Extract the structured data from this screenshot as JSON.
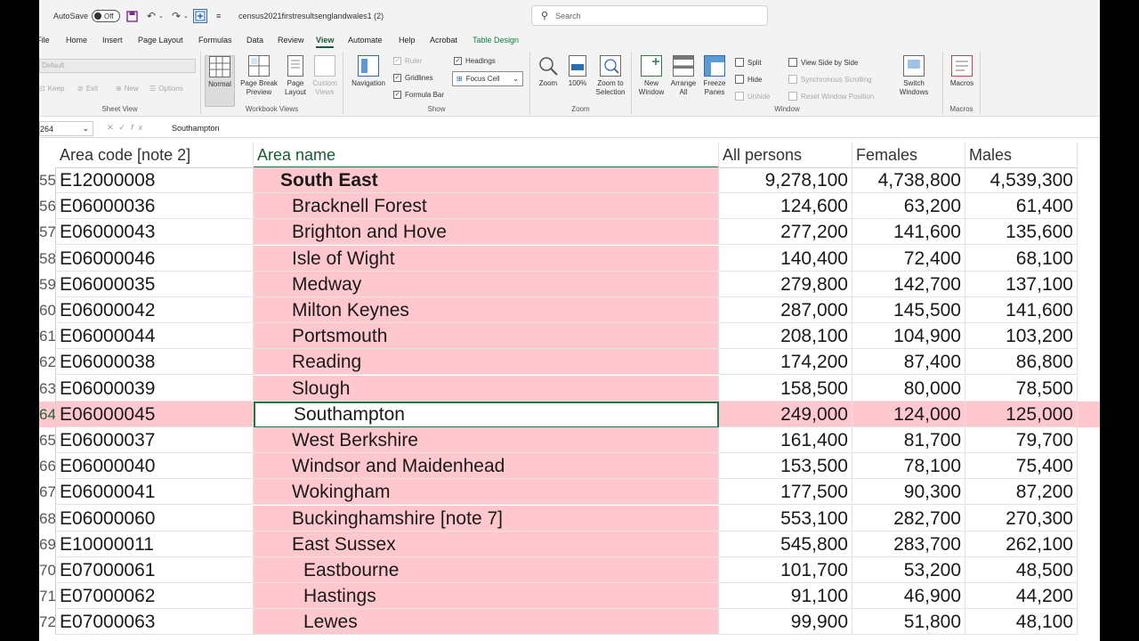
{
  "titlebar": {
    "autosave_label": "AutoSave",
    "autosave_state": "Off",
    "filename": "census2021firstresultsenglandwales1 (2)",
    "search_placeholder": "Search"
  },
  "tabs": [
    "File",
    "Home",
    "Insert",
    "Page Layout",
    "Formulas",
    "Data",
    "Review",
    "View",
    "Automate",
    "Help",
    "Acrobat",
    "Table Design"
  ],
  "active_tab": "View",
  "ribbon": {
    "sheet_view": {
      "dropdown": "Default",
      "keep": "Keep",
      "exit": "Exit",
      "new": "New",
      "options": "Options",
      "label": "Sheet View"
    },
    "workbook_views": {
      "normal": "Normal",
      "page_break": "Page Break Preview",
      "page_layout": "Page Layout",
      "custom": "Custom Views",
      "label": "Workbook Views"
    },
    "show": {
      "navigation": "Navigation",
      "ruler": "Ruler",
      "gridlines": "Gridlines",
      "formula_bar": "Formula Bar",
      "headings": "Headings",
      "focus_cell": "Focus Cell",
      "label": "Show"
    },
    "zoom": {
      "zoom": "Zoom",
      "hundred": "100%",
      "to_selection": "Zoom to Selection",
      "label": "Zoom"
    },
    "window": {
      "new_window": "New Window",
      "arrange_all": "Arrange All",
      "freeze_panes": "Freeze Panes",
      "split": "Split",
      "hide": "Hide",
      "unhide": "Unhide",
      "side_by_side": "View Side by Side",
      "sync_scroll": "Synchronous Scrolling",
      "reset_pos": "Reset Window Position",
      "switch_windows": "Switch Windows",
      "label": "Window"
    },
    "macros": {
      "macros": "Macros",
      "label": "Macros"
    }
  },
  "formula_bar": {
    "name_box": "264",
    "fx": "fx",
    "content": "Southampton"
  },
  "grid": {
    "headers": [
      "Area code [note 2]",
      "Area name",
      "All persons",
      "Females",
      "Males"
    ],
    "rows": [
      {
        "num": "55",
        "code": "E12000008",
        "name": "South East",
        "all": "9,278,100",
        "f": "4,738,800",
        "m": "4,539,300",
        "level": 0
      },
      {
        "num": "56",
        "code": "E06000036",
        "name": "Bracknell Forest",
        "all": "124,600",
        "f": "63,200",
        "m": "61,400",
        "level": 1
      },
      {
        "num": "57",
        "code": "E06000043",
        "name": "Brighton and Hove",
        "all": "277,200",
        "f": "141,600",
        "m": "135,600",
        "level": 1
      },
      {
        "num": "58",
        "code": "E06000046",
        "name": "Isle of Wight",
        "all": "140,400",
        "f": "72,400",
        "m": "68,100",
        "level": 1
      },
      {
        "num": "59",
        "code": "E06000035",
        "name": "Medway",
        "all": "279,800",
        "f": "142,700",
        "m": "137,100",
        "level": 1
      },
      {
        "num": "60",
        "code": "E06000042",
        "name": "Milton Keynes",
        "all": "287,000",
        "f": "145,500",
        "m": "141,600",
        "level": 1
      },
      {
        "num": "61",
        "code": "E06000044",
        "name": "Portsmouth",
        "all": "208,100",
        "f": "104,900",
        "m": "103,200",
        "level": 1
      },
      {
        "num": "62",
        "code": "E06000038",
        "name": "Reading",
        "all": "174,200",
        "f": "87,400",
        "m": "86,800",
        "level": 1
      },
      {
        "num": "63",
        "code": "E06000039",
        "name": "Slough",
        "all": "158,500",
        "f": "80,000",
        "m": "78,500",
        "level": 1
      },
      {
        "num": "64",
        "code": "E06000045",
        "name": "Southampton",
        "all": "249,000",
        "f": "124,000",
        "m": "125,000",
        "level": 1,
        "selected": true
      },
      {
        "num": "65",
        "code": "E06000037",
        "name": "West Berkshire",
        "all": "161,400",
        "f": "81,700",
        "m": "79,700",
        "level": 1
      },
      {
        "num": "66",
        "code": "E06000040",
        "name": "Windsor and Maidenhead",
        "all": "153,500",
        "f": "78,100",
        "m": "75,400",
        "level": 1
      },
      {
        "num": "67",
        "code": "E06000041",
        "name": "Wokingham",
        "all": "177,500",
        "f": "90,300",
        "m": "87,200",
        "level": 1
      },
      {
        "num": "68",
        "code": "E06000060",
        "name": "Buckinghamshire [note 7]",
        "all": "553,100",
        "f": "282,700",
        "m": "270,300",
        "level": 1
      },
      {
        "num": "69",
        "code": "E10000011",
        "name": "East Sussex",
        "all": "545,800",
        "f": "283,700",
        "m": "262,100",
        "level": 1
      },
      {
        "num": "70",
        "code": "E07000061",
        "name": "Eastbourne",
        "all": "101,700",
        "f": "53,200",
        "m": "48,500",
        "level": 2
      },
      {
        "num": "71",
        "code": "E07000062",
        "name": "Hastings",
        "all": "91,100",
        "f": "46,900",
        "m": "44,200",
        "level": 2
      },
      {
        "num": "72",
        "code": "E07000063",
        "name": "Lewes",
        "all": "99,900",
        "f": "51,800",
        "m": "48,100",
        "level": 2
      }
    ]
  },
  "colors": {
    "highlight": "#ffc7ce",
    "excel_green": "#217346"
  }
}
